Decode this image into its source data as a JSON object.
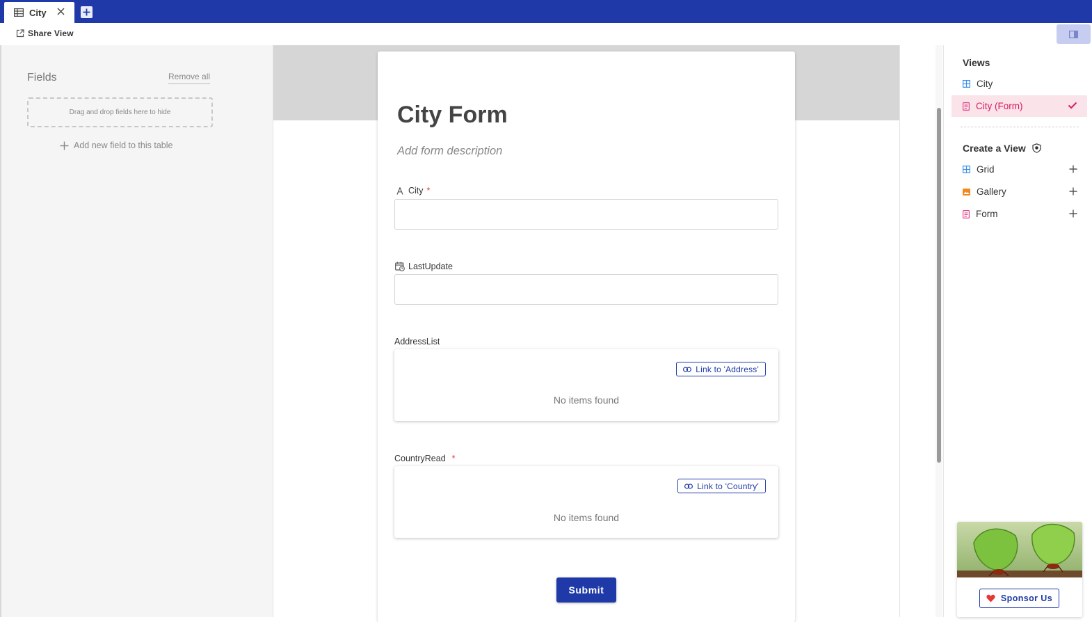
{
  "tabs": [
    {
      "label": "City",
      "icon": "grid-icon"
    }
  ],
  "toolbar": {
    "share_view_label": "Share View"
  },
  "left_panel": {
    "title": "Fields",
    "remove_all_label": "Remove all",
    "drop_zone_text": "Drag and drop fields here to hide",
    "add_field_label": "Add new field to this table"
  },
  "form": {
    "title": "City Form",
    "description_placeholder": "Add form description",
    "fields": [
      {
        "label": "City",
        "required": true,
        "required_mark": "*",
        "icon": "text-type-icon",
        "value": ""
      },
      {
        "label": "LastUpdate",
        "required": false,
        "icon": "calendar-clock-icon",
        "value": ""
      }
    ],
    "links": [
      {
        "label": "AddressList",
        "required": false,
        "link_button": "Link to 'Address'",
        "empty_text": "No items found"
      },
      {
        "label": "CountryRead",
        "required": true,
        "required_mark": "*",
        "link_button": "Link to 'Country'",
        "empty_text": "No items found"
      }
    ],
    "submit_label": "Submit"
  },
  "right_panel": {
    "views_heading": "Views",
    "views": [
      {
        "label": "City",
        "icon": "grid-icon",
        "active": false
      },
      {
        "label": "City (Form)",
        "icon": "form-icon",
        "active": true
      }
    ],
    "create_heading": "Create a View",
    "create_items": [
      {
        "label": "Grid",
        "icon": "grid-icon"
      },
      {
        "label": "Gallery",
        "icon": "gallery-icon"
      },
      {
        "label": "Form",
        "icon": "form-icon"
      }
    ],
    "sponsor_label": "Sponsor Us"
  },
  "colors": {
    "brand": "#1f3aa8",
    "active_view": "#d81b60",
    "required": "#e53935",
    "grid_icon": "#3b8ee8",
    "gallery_icon": "#f18a1d",
    "form_icon": "#e0458a"
  }
}
